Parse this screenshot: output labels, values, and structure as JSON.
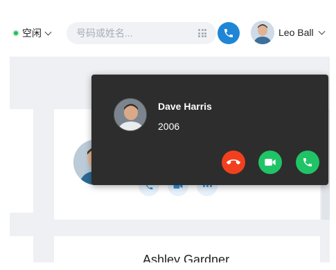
{
  "topbar": {
    "status": {
      "label": "空闲",
      "color": "#1fbf55",
      "icon": "chevron-down-icon"
    },
    "search": {
      "placeholder": "号码或姓名...",
      "value": "",
      "icon": "dialpad-icon"
    },
    "call_button": {
      "icon": "phone-icon",
      "color": "#1f86d6"
    },
    "user": {
      "name": "Leo Ball",
      "icon": "chevron-down-icon"
    }
  },
  "contact_card": {
    "actions": [
      {
        "icon": "phone-icon"
      },
      {
        "icon": "video-icon"
      },
      {
        "icon": "more-icon"
      }
    ]
  },
  "next_contact": {
    "name": "Ashley Gardner"
  },
  "incoming_call": {
    "caller_name": "Dave Harris",
    "caller_number": "2006",
    "buttons": [
      {
        "icon": "hangup-icon",
        "color": "#f2401f"
      },
      {
        "icon": "video-icon",
        "color": "#21c367"
      },
      {
        "icon": "phone-icon",
        "color": "#21c367"
      }
    ]
  }
}
